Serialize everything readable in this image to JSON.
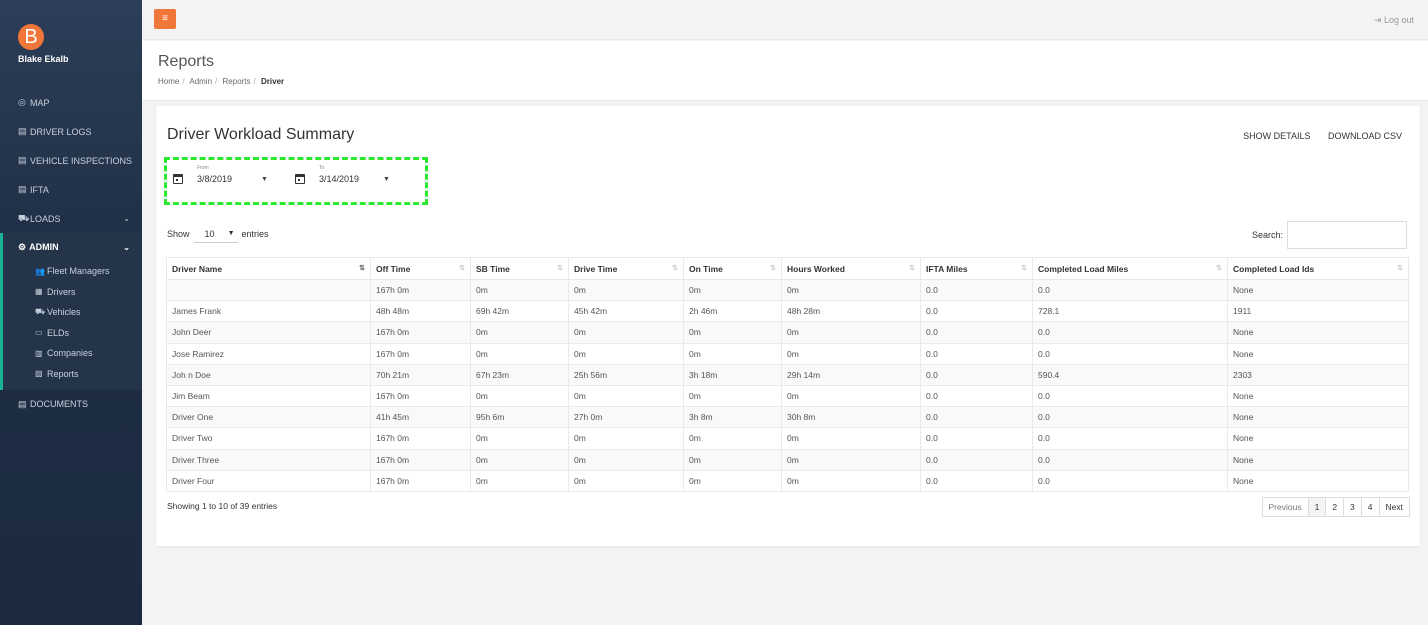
{
  "colors": {
    "accent": "#f0763a",
    "sidebar": "#2c3e58",
    "highlight": "#2ee82e",
    "active_bar": "#1ab394"
  },
  "sidebar": {
    "avatar_letter": "B",
    "user_name": "Blake Ekalb",
    "items": [
      {
        "icon": "map-pin-icon",
        "glyph": "◎",
        "label": "MAP"
      },
      {
        "icon": "file-icon",
        "glyph": "▤",
        "label": "DRIVER LOGS"
      },
      {
        "icon": "file-icon",
        "glyph": "▤",
        "label": "VEHICLE INSPECTIONS"
      },
      {
        "icon": "file-icon",
        "glyph": "▤",
        "label": "IFTA"
      },
      {
        "icon": "truck-icon",
        "glyph": "⛟",
        "label": "LOADS"
      }
    ],
    "admin": {
      "label": "ADMIN",
      "glyph": "⚙",
      "subitems": [
        {
          "glyph": "👥",
          "label": "Fleet Managers"
        },
        {
          "glyph": "▦",
          "label": "Drivers"
        },
        {
          "glyph": "⛟",
          "label": "Vehicles"
        },
        {
          "glyph": "▭",
          "label": "ELDs"
        },
        {
          "glyph": "▥",
          "label": "Companies"
        },
        {
          "glyph": "▨",
          "label": "Reports"
        }
      ]
    },
    "documents": {
      "glyph": "▤",
      "label": "DOCUMENTS"
    }
  },
  "topbar": {
    "menu_glyph": "≡",
    "logout_label": "Log out"
  },
  "header": {
    "title": "Reports",
    "breadcrumb": [
      "Home",
      "Admin",
      "Reports",
      "Driver"
    ]
  },
  "card": {
    "title": "Driver Workload Summary",
    "show_details": "SHOW DETAILS",
    "download_csv": "DOWNLOAD CSV",
    "from_label": "From",
    "from_value": "3/8/2019",
    "to_label": "To",
    "to_value": "3/14/2019",
    "show_label": "Show",
    "entries_value": "10",
    "entries_label": "entries",
    "search_label": "Search:",
    "info": "Showing 1 to 10 of 39 entries",
    "pagination": [
      "Previous",
      "1",
      "2",
      "3",
      "4",
      "Next"
    ]
  },
  "table": {
    "headers": [
      "Driver Name",
      "Off Time",
      "SB Time",
      "Drive Time",
      "On Time",
      "Hours Worked",
      "IFTA Miles",
      "Completed Load Miles",
      "Completed Load Ids"
    ],
    "rows": [
      [
        "",
        "167h 0m",
        "0m",
        "0m",
        "0m",
        "0m",
        "0.0",
        "0.0",
        "None"
      ],
      [
        "James Frank",
        "48h 48m",
        "69h 42m",
        "45h 42m",
        "2h 46m",
        "48h 28m",
        "0.0",
        "728.1",
        "1911"
      ],
      [
        "John Deer",
        "167h 0m",
        "0m",
        "0m",
        "0m",
        "0m",
        "0.0",
        "0.0",
        "None"
      ],
      [
        "Jose Ramirez",
        "167h 0m",
        "0m",
        "0m",
        "0m",
        "0m",
        "0.0",
        "0.0",
        "None"
      ],
      [
        "Joh n Doe",
        "70h 21m",
        "67h 23m",
        "25h 56m",
        "3h 18m",
        "29h 14m",
        "0.0",
        "590.4",
        "2303"
      ],
      [
        "Jim Beam",
        "167h 0m",
        "0m",
        "0m",
        "0m",
        "0m",
        "0.0",
        "0.0",
        "None"
      ],
      [
        "Driver One",
        "41h 45m",
        "95h 6m",
        "27h 0m",
        "3h 8m",
        "30h 8m",
        "0.0",
        "0.0",
        "None"
      ],
      [
        "Driver Two",
        "167h 0m",
        "0m",
        "0m",
        "0m",
        "0m",
        "0.0",
        "0.0",
        "None"
      ],
      [
        "Driver Three",
        "167h 0m",
        "0m",
        "0m",
        "0m",
        "0m",
        "0.0",
        "0.0",
        "None"
      ],
      [
        "Driver Four",
        "167h 0m",
        "0m",
        "0m",
        "0m",
        "0m",
        "0.0",
        "0.0",
        "None"
      ]
    ]
  }
}
